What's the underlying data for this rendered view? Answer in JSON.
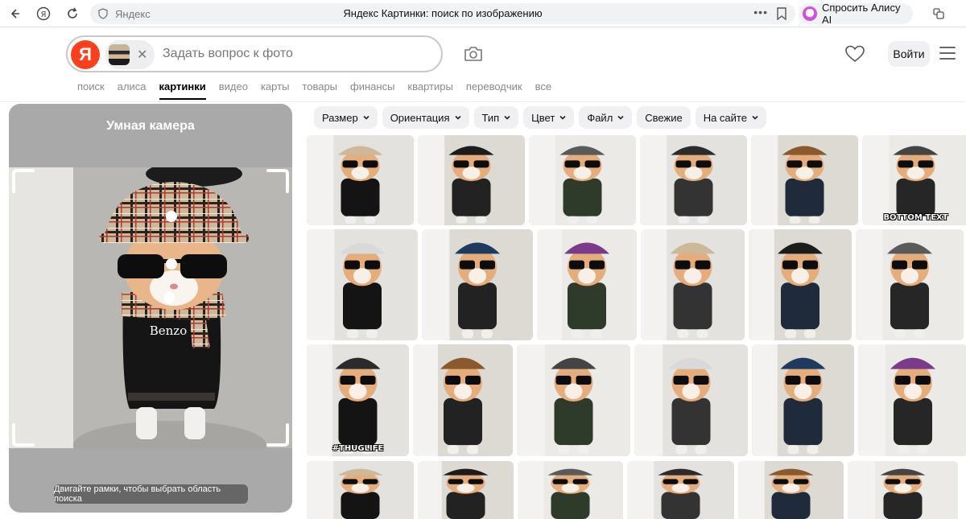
{
  "browser": {
    "domain": "Яндекс",
    "tab_title": "Яндекс Картинки: поиск по изображению",
    "alice_label": "Спросить Алису AI"
  },
  "header": {
    "logo_letter": "Я",
    "search_placeholder": "Задать вопрос к фото",
    "login_label": "Войти"
  },
  "tabs": [
    {
      "label": "поиск",
      "active": false
    },
    {
      "label": "алиса",
      "active": false
    },
    {
      "label": "картинки",
      "active": true
    },
    {
      "label": "видео",
      "active": false
    },
    {
      "label": "карты",
      "active": false
    },
    {
      "label": "товары",
      "active": false
    },
    {
      "label": "финансы",
      "active": false
    },
    {
      "label": "квартиры",
      "active": false
    },
    {
      "label": "переводчик",
      "active": false
    },
    {
      "label": "все",
      "active": false
    }
  ],
  "smart_camera": {
    "title": "Умная камера",
    "hint": "Двигайте рамки, чтобы выбрать область поиска",
    "shirt_text": "Benzo"
  },
  "filters": [
    {
      "label": "Размер",
      "dropdown": true
    },
    {
      "label": "Ориентация",
      "dropdown": true
    },
    {
      "label": "Тип",
      "dropdown": true
    },
    {
      "label": "Цвет",
      "dropdown": true
    },
    {
      "label": "Файл",
      "dropdown": true
    },
    {
      "label": "Свежие",
      "dropdown": false
    },
    {
      "label": "На сайте",
      "dropdown": true
    }
  ],
  "results": {
    "captions": [
      "BOTTOM TEXT",
      "#THUGLIFE"
    ]
  },
  "colors": {
    "yandex_red": "#fc3f1d",
    "chip_bg": "#f0f0f2",
    "panel_bg": "#a9a9aa",
    "alice_pink": "#d44fe0"
  }
}
